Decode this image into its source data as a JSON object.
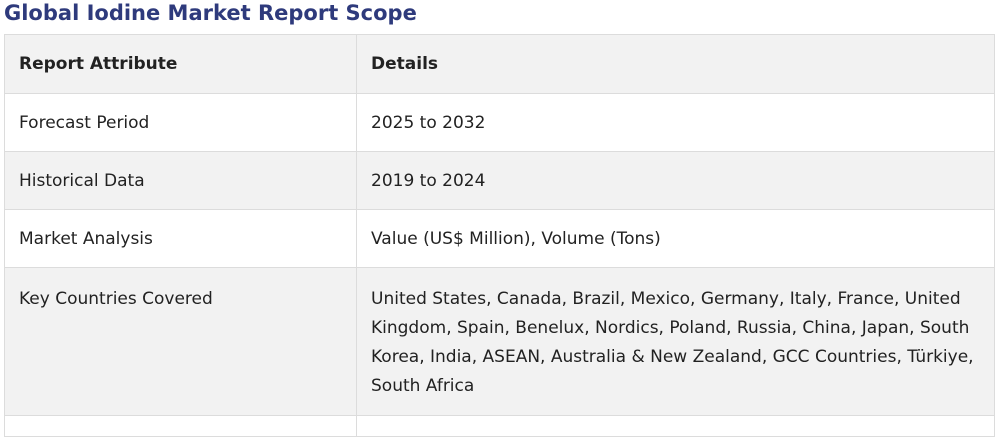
{
  "page": {
    "title": "Global Iodine Market Report Scope"
  },
  "table": {
    "headers": [
      "Report Attribute",
      "Details"
    ],
    "rows": [
      {
        "attribute": "Forecast Period",
        "details": "2025 to 2032"
      },
      {
        "attribute": "Historical Data",
        "details": "2019 to 2024"
      },
      {
        "attribute": "Market Analysis",
        "details": "Value (US$ Million), Volume (Tons)"
      },
      {
        "attribute": "Key Countries Covered",
        "details": "United States, Canada, Brazil, Mexico, Germany, Italy, France, United Kingdom, Spain, Benelux, Nordics, Poland, Russia, China, Japan, South Korea, India, ASEAN, Australia & New Zealand, GCC Countries, Türkiye, South Africa"
      }
    ]
  },
  "colors": {
    "title": "#2e3a7c",
    "header_bg": "#f2f2f2",
    "stripe_bg": "#f2f2f2",
    "border": "#dcdcdc"
  }
}
